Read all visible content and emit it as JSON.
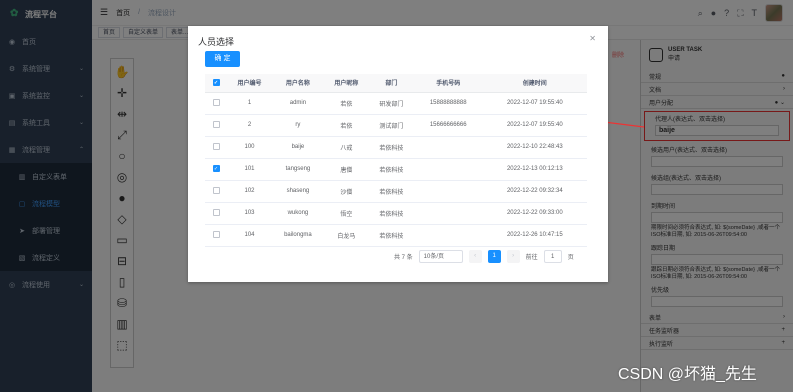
{
  "sidebar": {
    "brand": "流程平台",
    "items": [
      {
        "label": "首页",
        "icon": "dashboard-icon"
      },
      {
        "label": "系统管理",
        "icon": "gear-icon"
      },
      {
        "label": "系统监控",
        "icon": "monitor-icon"
      },
      {
        "label": "系统工具",
        "icon": "tool-icon"
      },
      {
        "label": "流程管理",
        "icon": "flow-icon"
      },
      {
        "label": "自定义表单",
        "icon": "form-icon"
      },
      {
        "label": "流程模型",
        "icon": "model-icon"
      },
      {
        "label": "部署管理",
        "icon": "deploy-icon"
      },
      {
        "label": "流程定义",
        "icon": "define-icon"
      },
      {
        "label": "流程使用",
        "icon": "use-icon"
      }
    ]
  },
  "header": {
    "breadcrumb_home": "首页",
    "breadcrumb_current": "流程设计",
    "tags": [
      "首页",
      "自定义表单",
      "表单..."
    ]
  },
  "panel": {
    "task_type": "USER TASK",
    "task_name": "申请",
    "sections": [
      "常规",
      "文档",
      "用户分配"
    ],
    "assignee_label": "代理人(表达式、双击选择)",
    "assignee_value": "baije",
    "candidate_users_label": "候选用户(表达式、双击选择)",
    "candidate_groups_label": "候选组(表达式、双击选择)",
    "due_date_label": "到期时间",
    "due_date_hint": "期限时间必须符合表达式, 如: ${someDate} ,或者一个ISO标准日期, 如: 2015-06-26T09:54:00",
    "follow_up_label": "跟踪日期",
    "follow_up_hint": "跟踪日期必须符合表达式, 如: ${someDate} ,或者一个ISO标准日期, 如: 2015-06-26T09:54:00",
    "priority_label": "优先级",
    "more_sections": [
      "表单",
      "任务监听器",
      "执行监听"
    ],
    "delete_label": "删除"
  },
  "dialog": {
    "title": "人员选择",
    "confirm_label": "确 定",
    "columns": [
      "用户编号",
      "用户名称",
      "用户昵称",
      "部门",
      "手机号码",
      "创建时间"
    ],
    "rows": [
      {
        "id": "1",
        "name": "admin",
        "nick": "若依",
        "dept": "研发部门",
        "phone": "15888888888",
        "time": "2022-12-07 19:55:40",
        "checked": false
      },
      {
        "id": "2",
        "name": "ry",
        "nick": "若依",
        "dept": "测试部门",
        "phone": "15666666666",
        "time": "2022-12-07 19:55:40",
        "checked": false
      },
      {
        "id": "100",
        "name": "baije",
        "nick": "八戒",
        "dept": "若依科技",
        "phone": "",
        "time": "2022-12-10 22:48:43",
        "checked": false
      },
      {
        "id": "101",
        "name": "tangseng",
        "nick": "唐僧",
        "dept": "若依科技",
        "phone": "",
        "time": "2022-12-13 00:12:13",
        "checked": true
      },
      {
        "id": "102",
        "name": "shaseng",
        "nick": "沙僧",
        "dept": "若依科技",
        "phone": "",
        "time": "2022-12-22 09:32:34",
        "checked": false
      },
      {
        "id": "103",
        "name": "wukong",
        "nick": "悟空",
        "dept": "若依科技",
        "phone": "",
        "time": "2022-12-22 09:33:00",
        "checked": false
      },
      {
        "id": "104",
        "name": "bailongma",
        "nick": "白龙马",
        "dept": "若依科技",
        "phone": "",
        "time": "2022-12-26 10:47:15",
        "checked": false
      }
    ],
    "pager": {
      "total": "共 7 条",
      "page_size": "10条/页",
      "current_page": "1",
      "goto": "前往",
      "goto_value": "1",
      "page_unit": "页"
    }
  },
  "watermark": "CSDN @坏猫_先生"
}
